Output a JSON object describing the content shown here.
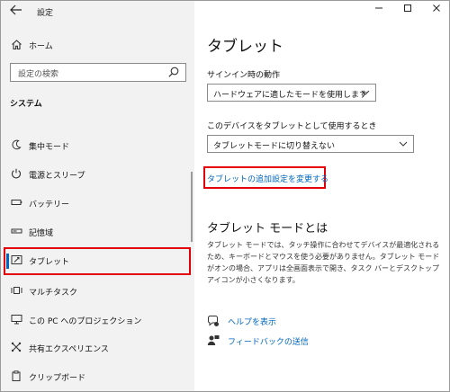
{
  "window": {
    "title": "設定"
  },
  "sidebar": {
    "home_label": "ホーム",
    "search_placeholder": "設定の検索",
    "section_label": "システム",
    "items": [
      {
        "label": "集中モード",
        "icon": "moon-icon"
      },
      {
        "label": "電源とスリープ",
        "icon": "power-icon"
      },
      {
        "label": "バッテリー",
        "icon": "battery-icon"
      },
      {
        "label": "記憶域",
        "icon": "storage-icon"
      },
      {
        "label": "タブレット",
        "icon": "tablet-icon",
        "selected": true
      },
      {
        "label": "マルチタスク",
        "icon": "multitask-icon"
      },
      {
        "label": "この PC へのプロジェクション",
        "icon": "projection-icon"
      },
      {
        "label": "共有エクスペリエンス",
        "icon": "share-icon"
      },
      {
        "label": "クリップボード",
        "icon": "clipboard-icon"
      }
    ]
  },
  "main": {
    "title": "タブレット",
    "signin_label": "サインイン時の動作",
    "signin_value": "ハードウェアに適したモードを使用します",
    "tablet_use_label": "このデバイスをタブレットとして使用するとき",
    "tablet_use_value": "タブレットモードに切り替えない",
    "additional_link": "タブレットの追加設定を変更する",
    "about_title": "タブレット モードとは",
    "about_desc": "タブレット モードでは、タッチ操作に合わせてデバイスが最適化されるため、キーボードとマウスを使う必要がありません。タブレット モードがオンの場合、アプリは全画面表示で開き、タスク バーとデスクトップ アイコンが小さくなります。",
    "help_link": "ヘルプを表示",
    "feedback_link": "フィードバックの送信"
  },
  "colors": {
    "accent": "#0067c0",
    "highlight_red": "#e3000b",
    "sidebar_bg": "#f2f2f2"
  }
}
